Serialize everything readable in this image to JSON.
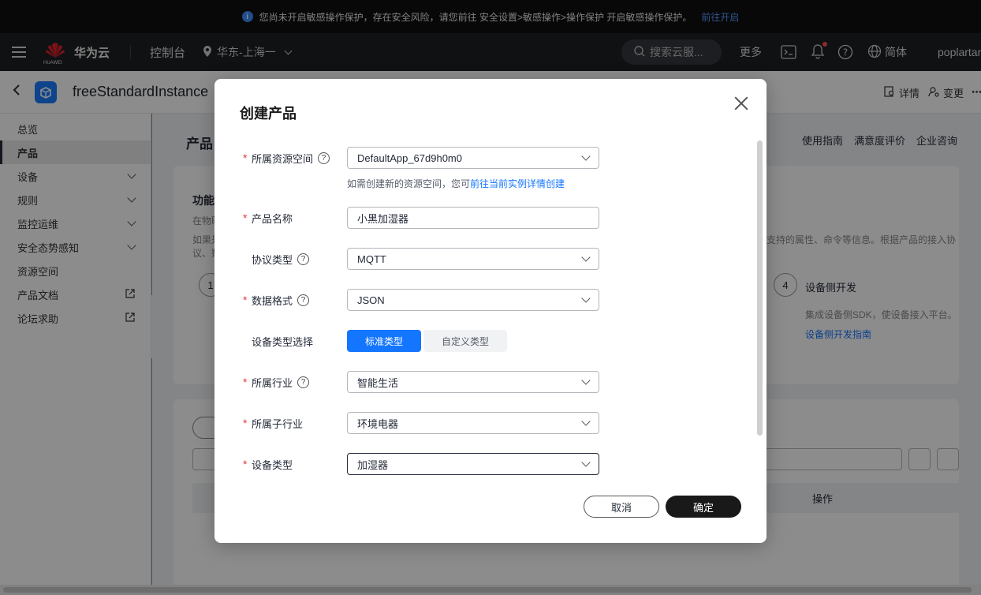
{
  "notice": {
    "text": "您尚未开启敏感操作保护，存在安全风险，请您前往 安全设置>敏感操作>操作保护 开启敏感操作保护。",
    "link": "前往开启"
  },
  "topbar": {
    "brand": "华为云",
    "brand_small": "HUAWEI",
    "console": "控制台",
    "region": "华东-上海一",
    "search_placeholder": "搜索云服...",
    "more": "更多",
    "lang": "简体",
    "user": "poplartan"
  },
  "subheader": {
    "instance_name": "freeStandardInstance",
    "details": "详情",
    "change": "变更",
    "more": "⋯"
  },
  "sidebar": {
    "items": [
      {
        "label": "总览"
      },
      {
        "label": "产品"
      },
      {
        "label": "设备"
      },
      {
        "label": "规则"
      },
      {
        "label": "监控运维"
      },
      {
        "label": "安全态势感知"
      },
      {
        "label": "资源空间"
      },
      {
        "label": "产品文档"
      },
      {
        "label": "论坛求助"
      }
    ]
  },
  "main": {
    "title": "产品",
    "links": [
      "使用指南",
      "满意度评价",
      "企业咨询"
    ],
    "card": {
      "heading": "功能",
      "text1": "在物联",
      "text2": "如果是",
      "text2_right": "支持的属性、命令等信息。根据产品的接入协",
      "text3": "议、数",
      "step1": "1",
      "step4_num": "4",
      "step4_title": "设备侧开发",
      "step4_desc": "集成设备侧SDK，使设备接入平台。",
      "step4_link": "设备侧开发指南"
    },
    "table_header_op": "操作"
  },
  "modal": {
    "title": "创建产品",
    "fields": {
      "resource_space": {
        "label": "所属资源空间",
        "value": "DefaultApp_67d9h0m0"
      },
      "hint_prefix": "如需创建新的资源空间，您可",
      "hint_link": "前往当前实例详情创建",
      "product_name": {
        "label": "产品名称",
        "value": "小黑加湿器"
      },
      "protocol": {
        "label": "协议类型",
        "value": "MQTT"
      },
      "data_format": {
        "label": "数据格式",
        "value": "JSON"
      },
      "device_type_choice": {
        "label": "设备类型选择",
        "options": [
          "标准类型",
          "自定义类型"
        ],
        "selected": "标准类型"
      },
      "industry": {
        "label": "所属行业",
        "value": "智能生活"
      },
      "sub_industry": {
        "label": "所属子行业",
        "value": "环境电器"
      },
      "device_type": {
        "label": "设备类型",
        "value": "加湿器"
      }
    },
    "cancel": "取消",
    "confirm": "确定"
  },
  "colors": {
    "primary": "#1476ff",
    "required": "#e4393c",
    "confirm_bg": "#191919"
  }
}
